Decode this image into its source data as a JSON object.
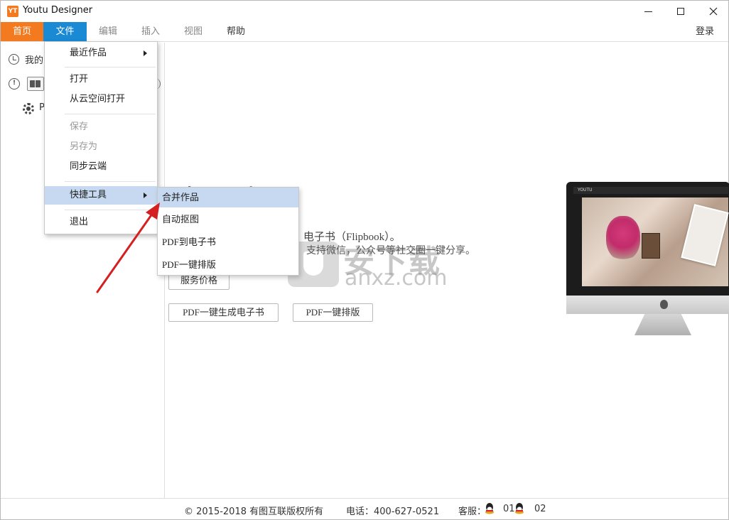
{
  "window": {
    "logo_text": "YT",
    "title": "Youtu Designer"
  },
  "menubar": {
    "items": [
      {
        "label": "首页"
      },
      {
        "label": "文件"
      },
      {
        "label": "编辑"
      },
      {
        "label": "插入"
      },
      {
        "label": "视图"
      },
      {
        "label": "帮助"
      }
    ],
    "login_label": "登录",
    "home_color": "#f47a1f",
    "active_color": "#1a8ad4"
  },
  "sidebar": {
    "recent_label": "我的",
    "settings_label": "P"
  },
  "main": {
    "hero_title": "电子书",
    "hero_line1": "电子书（Flipbook）。",
    "hero_line2": "支持微信，公众号等社交圈一键分享。",
    "buttons": {
      "service": "服务价格",
      "generate": "PDF一键生成电子书",
      "layout": "PDF一键排版"
    },
    "watermark_cn": "安下载",
    "watermark_en": "anxz.com",
    "monitor_brand": "YOUTU"
  },
  "file_menu": {
    "items": [
      {
        "label": "最近作品",
        "has_submenu": true
      },
      {
        "label": "打开"
      },
      {
        "label": "从云空间打开"
      },
      {
        "label": "保存",
        "disabled": true
      },
      {
        "label": "另存为",
        "disabled": true
      },
      {
        "label": "同步云端"
      },
      {
        "label": "快捷工具",
        "has_submenu": true,
        "highlighted": true
      },
      {
        "label": "退出"
      }
    ],
    "highlight_color": "#c7d9f0"
  },
  "tools_submenu": {
    "items": [
      {
        "label": "合并作品",
        "highlighted": true
      },
      {
        "label": "自动抠图"
      },
      {
        "label": "PDF到电子书"
      },
      {
        "label": "PDF一键排版"
      }
    ]
  },
  "annotation": {
    "arrow_color": "#d42020"
  },
  "statusbar": {
    "copyright": "© 2015-2018 有图互联版权所有",
    "phone": "电话：400-627-0521",
    "service_label": "客服：",
    "qq1": "01",
    "qq2": "02"
  }
}
